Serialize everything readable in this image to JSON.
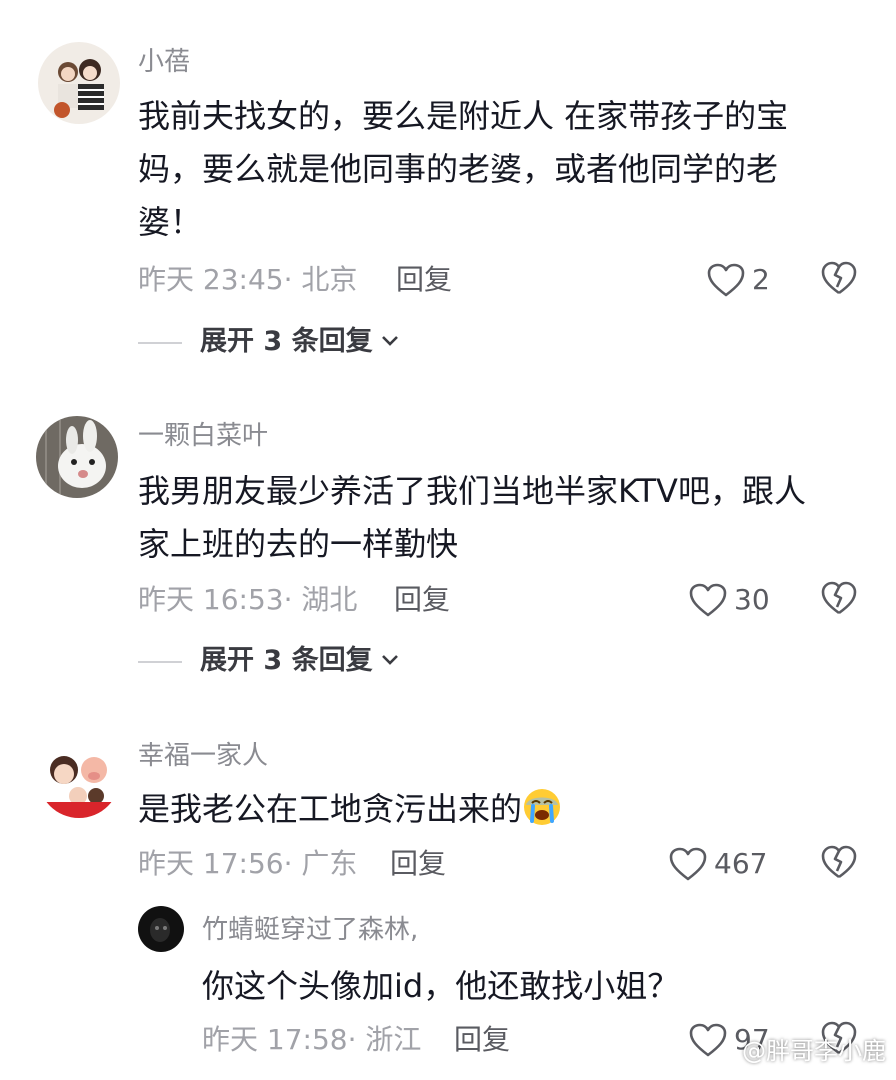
{
  "comments": [
    {
      "username": "小蓓",
      "text": "我前夫找女的，要么是附近人 在家带孩子的宝妈，要么就是他同事的老婆，或者他同学的老婆！",
      "time": "昨天 23:45· 北京",
      "reply_label": "回复",
      "likes": "2",
      "expand_label": "展开 3 条回复"
    },
    {
      "username": "一颗白菜叶",
      "text": "我男朋友最少养活了我们当地半家KTV吧，跟人家上班的去的一样勤快",
      "time": "昨天 16:53· 湖北",
      "reply_label": "回复",
      "likes": "30",
      "expand_label": "展开 3 条回复"
    },
    {
      "username": "幸福一家人",
      "text": "是我老公在工地贪污出来的",
      "emoji": "crying-face",
      "time": "昨天 17:56· 广东",
      "reply_label": "回复",
      "likes": "467",
      "reply": {
        "username": "竹蜻蜓穿过了森林,",
        "text": "你这个头像加id，他还敢找小姐？",
        "time": "昨天 17:58· 浙江",
        "reply_label": "回复",
        "likes": "97"
      }
    }
  ],
  "watermark": "@胖哥李小鹿",
  "colors": {
    "text": "#161823",
    "muted": "#8a8b91",
    "meta": "#a1a2a8"
  }
}
